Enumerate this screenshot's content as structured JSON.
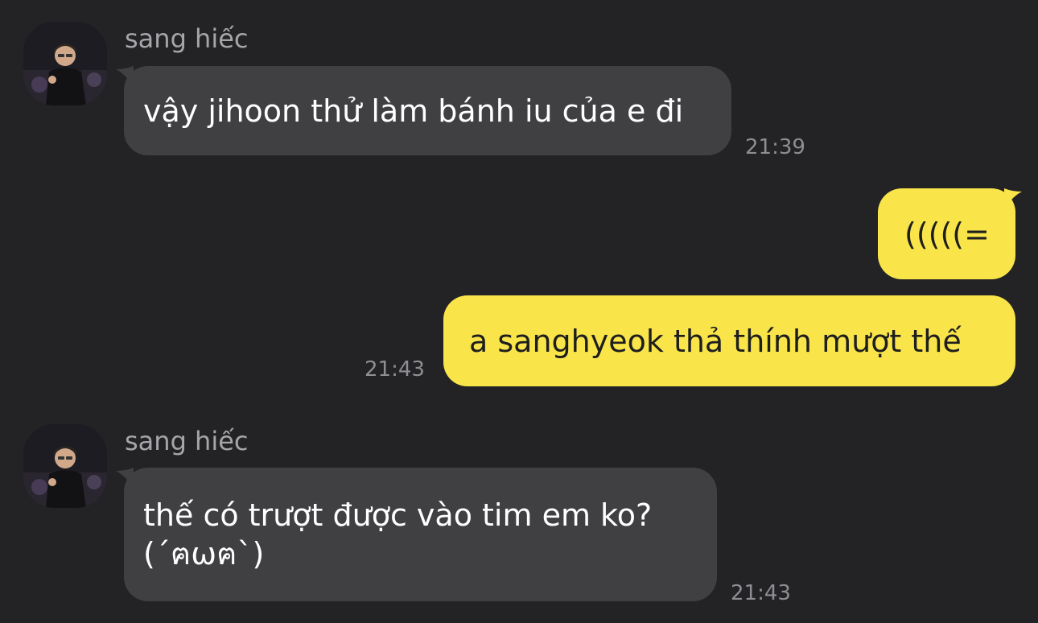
{
  "messages": [
    {
      "sender": "sang hiếc",
      "text": "vậy jihoon thử làm bánh iu của e đi",
      "time": "21:39"
    },
    {
      "text": "(((((="
    },
    {
      "text": "a sanghyeok thả thính mượt thế",
      "time": "21:43"
    },
    {
      "sender": "sang hiếc",
      "text_line1": "thế có trượt được vào tim em ko?",
      "text_line2": "(´ฅωฅ`)",
      "time": "21:43"
    }
  ],
  "colors": {
    "background": "#232325",
    "incoming_bubble": "#404043",
    "outgoing_bubble": "#f9e54a",
    "sender_name": "#a6a6aa",
    "timestamp": "#8e8e93"
  },
  "icons": [
    "profile-avatar"
  ]
}
